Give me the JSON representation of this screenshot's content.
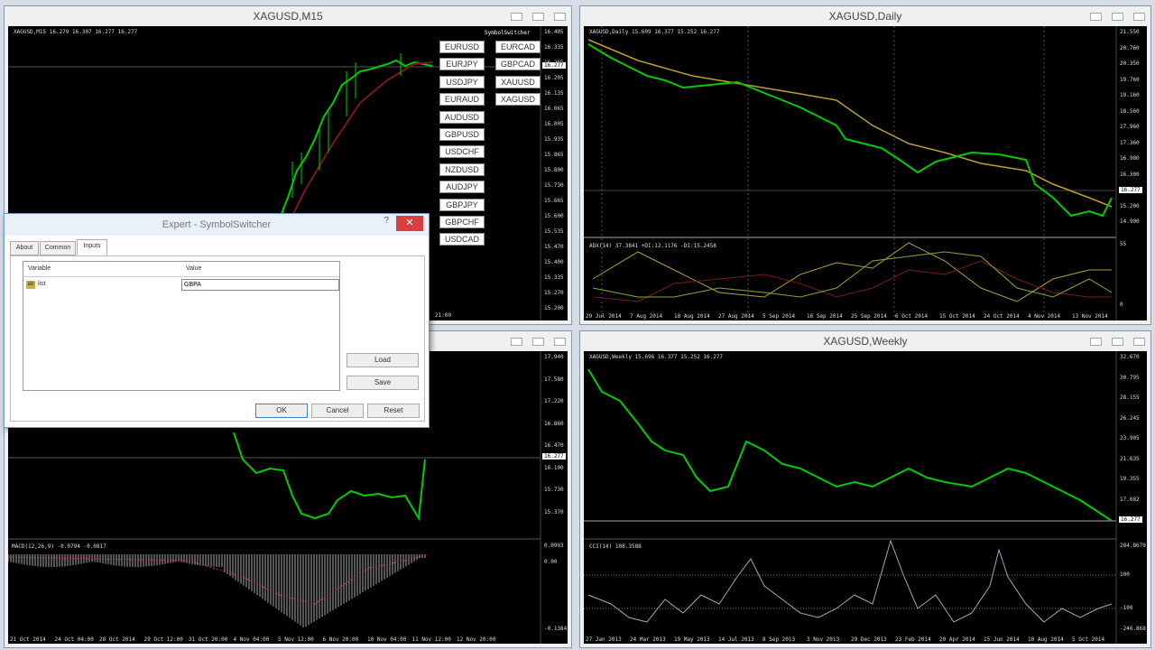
{
  "windows": {
    "m15": {
      "title": "XAGUSD,M15",
      "info": "XAGUSD,M15  16.279 16.307 16.277 16.277",
      "prices": [
        "16.405",
        "16.335",
        "16.265",
        "16.205",
        "16.135",
        "16.065",
        "16.005",
        "15.935",
        "15.865",
        "15.800",
        "15.730",
        "15.665",
        "15.600",
        "15.535",
        "15.470",
        "15.400",
        "15.335",
        "15.270",
        "15.200"
      ],
      "time_last": "21:00",
      "price_badge": "16.277"
    },
    "daily": {
      "title": "XAGUSD,Daily",
      "info": "XAGUSD,Daily  15.609 16.377 15.252 16.277",
      "prices": [
        "21.550",
        "20.760",
        "20.350",
        "19.760",
        "19.160",
        "18.560",
        "17.960",
        "17.360",
        "16.980",
        "16.300",
        "15.800",
        "15.200",
        "14.900"
      ],
      "price_badge": "16.277",
      "adx_label": "ADX(14) 37.3841 +DI:12.1176 -DI:15.2458",
      "adx_scale": [
        "55",
        "0"
      ],
      "dates": [
        "29 Jul 2014",
        "7 Aug 2014",
        "18 Aug 2014",
        "27 Aug 2014",
        "5 Sep 2014",
        "16 Sep 2014",
        "25 Sep 2014",
        "6 Oct 2014",
        "15 Oct 2014",
        "24 Oct 2014",
        "4 Nov 2014",
        "13 Nov 2014"
      ]
    },
    "bottom_left": {
      "prices": [
        "17.940",
        "17.580",
        "17.220",
        "16.860",
        "16.470",
        "16.100",
        "15.730",
        "15.370"
      ],
      "price_badge": "16.277",
      "macd_label": "MACD(12,26,9) -0.0794 -0.0817",
      "macd_scale": [
        "0.0993",
        "0.00",
        "-0.1384"
      ],
      "dates": [
        "21 Oct 2014",
        "24 Oct 04:00",
        "28 Oct 2014",
        "29 Oct 12:00",
        "31 Oct 20:00",
        "4 Nov 04:00",
        "5 Nov 12:00",
        "6 Nov 20:00",
        "10 Nov 04:00",
        "11 Nov 12:00",
        "12 Nov 20:00"
      ]
    },
    "weekly": {
      "title": "XAGUSD,Weekly",
      "info": "XAGUSD,Weekly  15.696 16.377 15.252 16.277",
      "prices": [
        "32.670",
        "30.795",
        "28.155",
        "26.245",
        "23.905",
        "21.635",
        "19.355",
        "17.082",
        "14.880"
      ],
      "price_badge": "16.277",
      "cci_label": "CCI(14) 108.3588",
      "cci_scale": [
        "284.8670",
        "100",
        "-100",
        "-246.868"
      ],
      "dates": [
        "27 Jan 2013",
        "24 Mar 2013",
        "19 May 2013",
        "14 Jul 2013",
        "8 Sep 2013",
        "3 Nov 2013",
        "29 Dec 2013",
        "23 Feb 2014",
        "20 Apr 2014",
        "15 Jun 2014",
        "10 Aug 2014",
        "5 Oct 2014"
      ]
    }
  },
  "symbol_switcher": {
    "header": "SymbolSwitcher",
    "left": [
      "EURUSD",
      "EURJPY",
      "USDJPY",
      "EURAUD",
      "AUDUSD",
      "GBPUSD",
      "USDCHF",
      "NZDUSD",
      "AUDJPY",
      "GBPJPY",
      "GBPCHF",
      "USDCAD"
    ],
    "right": [
      "EURCAD",
      "GBPCAD",
      "XAUUSD",
      "XAGUSD"
    ]
  },
  "dialog": {
    "title": "Expert - SymbolSwitcher",
    "close": "✕",
    "help": "?",
    "tabs": [
      "About",
      "Common",
      "Inputs"
    ],
    "columns": {
      "variable": "Variable",
      "value": "Value"
    },
    "row": {
      "variable": "list",
      "value": "GBPA"
    },
    "buttons": {
      "load": "Load",
      "save": "Save",
      "ok": "OK",
      "cancel": "Cancel",
      "reset": "Reset"
    }
  }
}
